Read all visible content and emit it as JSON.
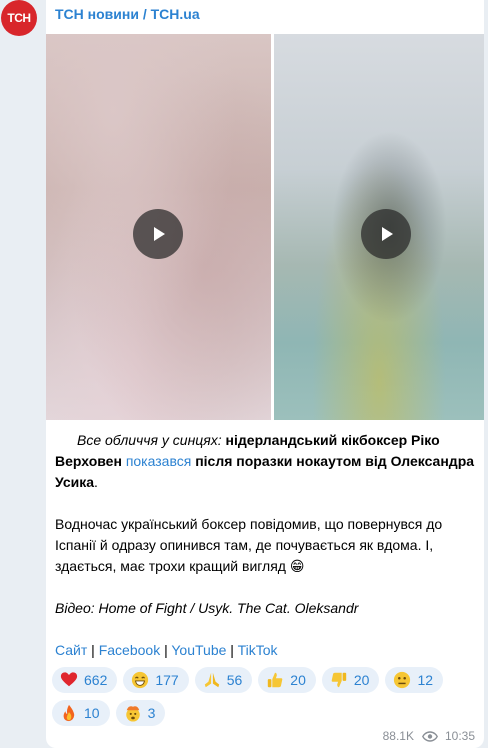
{
  "channel": {
    "name": "ТСН новини / TCH.ua",
    "avatar_text": "ТСН"
  },
  "post": {
    "intro_italic": "Все обличчя у синцях:",
    "bold_1": " нідерландський кікбоксер Ріко Верховен ",
    "link": "показався",
    "bold_2": " після поразки нокаутом від Олександра Усика",
    "period": ".",
    "paragraph_2": "Водночас український боксер повідомив, що повернувся до Іспанії й одразу опинився там, де почувається як вдома. І, здається, має трохи кращий вигляд 😁",
    "credit": "Відео: Home of Fight / Usyk. The Cat. Oleksandr",
    "links": [
      "Сайт",
      "Facebook",
      "YouTube",
      "TikTok"
    ],
    "separator": " | "
  },
  "reactions": [
    {
      "emoji": "heart-emoji",
      "count": "662"
    },
    {
      "emoji": "grin-emoji",
      "count": "177"
    },
    {
      "emoji": "pray-emoji",
      "count": "56"
    },
    {
      "emoji": "thumbs-up-emoji",
      "count": "20"
    },
    {
      "emoji": "thumbs-down-emoji",
      "count": "20"
    },
    {
      "emoji": "neutral-face-emoji",
      "count": "12"
    },
    {
      "emoji": "fire-emoji",
      "count": "10"
    },
    {
      "emoji": "exploding-head-emoji",
      "count": "3"
    }
  ],
  "meta": {
    "views": "88.1K",
    "time": "10:35"
  },
  "colors": {
    "accent": "#2c82d1",
    "brand_red": "#d8262b"
  }
}
